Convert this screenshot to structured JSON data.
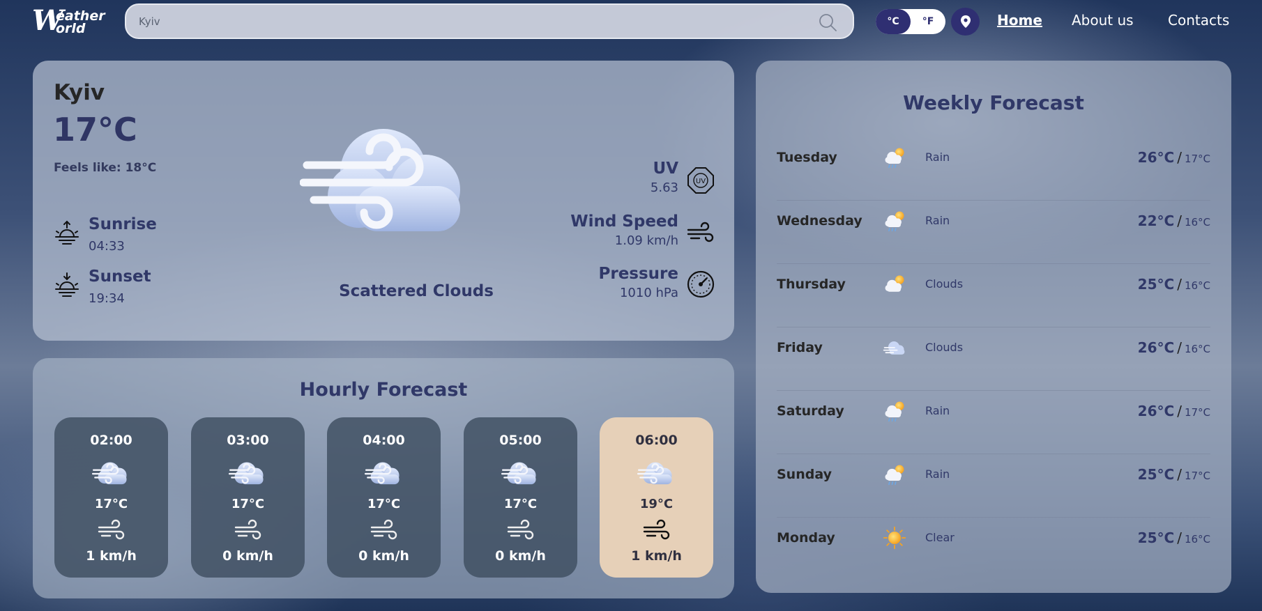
{
  "header": {
    "logo_big": "W",
    "logo_word_top": "eather",
    "logo_word_bottom": "orld",
    "search": {
      "value": "Kyiv",
      "placeholder": ""
    },
    "units": {
      "celsius": "°C",
      "fahrenheit": "°F",
      "active": "celsius"
    },
    "nav": {
      "home": "Home",
      "about": "About us",
      "contacts": "Contacts"
    }
  },
  "current": {
    "city": "Kyiv",
    "temperature": "17°C",
    "feels_like": "Feels like: 18°C",
    "sunrise": {
      "label": "Sunrise",
      "time": "04:33",
      "icon": "sunrise-icon"
    },
    "sunset": {
      "label": "Sunset",
      "time": "19:34",
      "icon": "sunset-icon"
    },
    "condition": "Scattered Clouds",
    "condition_icon": "windy-cloud-icon",
    "stats": {
      "uv": {
        "label": "UV",
        "value": "5.63",
        "icon": "uv-icon"
      },
      "wind": {
        "label": "Wind Speed",
        "value": "1.09 km/h",
        "icon": "wind-icon"
      },
      "pressure": {
        "label": "Pressure",
        "value": "1010 hPa",
        "icon": "gauge-icon"
      }
    }
  },
  "hourly": {
    "title": "Hourly Forecast",
    "items": [
      {
        "time": "02:00",
        "temp": "17°C",
        "wind": "1 km/h",
        "active": false
      },
      {
        "time": "03:00",
        "temp": "17°C",
        "wind": "0 km/h",
        "active": false
      },
      {
        "time": "04:00",
        "temp": "17°C",
        "wind": "0 km/h",
        "active": false
      },
      {
        "time": "05:00",
        "temp": "17°C",
        "wind": "0 km/h",
        "active": false
      },
      {
        "time": "06:00",
        "temp": "19°C",
        "wind": "1 km/h",
        "active": true
      }
    ]
  },
  "weekly": {
    "title": "Weekly Forecast",
    "separator": "/",
    "days": [
      {
        "day": "Tuesday",
        "condition": "Rain",
        "high": "26°C",
        "low": "17°C",
        "icon": "rain-sun-icon"
      },
      {
        "day": "Wednesday",
        "condition": "Rain",
        "high": "22°C",
        "low": "16°C",
        "icon": "rain-sun-icon"
      },
      {
        "day": "Thursday",
        "condition": "Clouds",
        "high": "25°C",
        "low": "16°C",
        "icon": "cloud-sun-icon"
      },
      {
        "day": "Friday",
        "condition": "Clouds",
        "high": "26°C",
        "low": "16°C",
        "icon": "windy-cloud-icon"
      },
      {
        "day": "Saturday",
        "condition": "Rain",
        "high": "26°C",
        "low": "17°C",
        "icon": "rain-sun-icon"
      },
      {
        "day": "Sunday",
        "condition": "Rain",
        "high": "25°C",
        "low": "17°C",
        "icon": "rain-sun-icon"
      },
      {
        "day": "Monday",
        "condition": "Clear",
        "high": "25°C",
        "low": "16°C",
        "icon": "sun-icon"
      }
    ]
  },
  "colors": {
    "accent": "#2f2f72",
    "title_text": "#303868",
    "active_hour_card": "#e6d0b8",
    "hour_card": "#3e4e60"
  }
}
